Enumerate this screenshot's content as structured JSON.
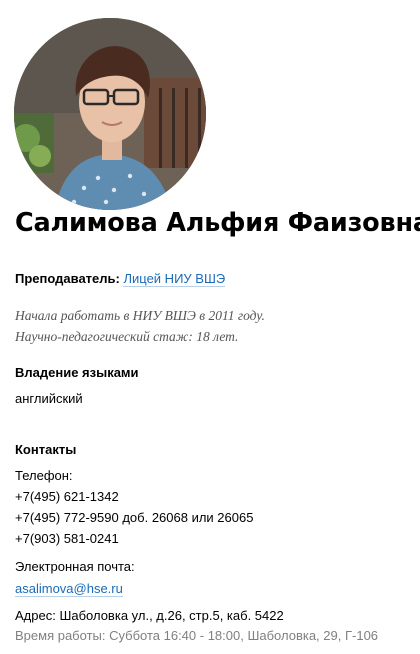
{
  "person": {
    "full_name": "Салимова Альфия Фаизовна",
    "position_label": "Преподаватель:",
    "organization": "Лицей НИУ ВШЭ",
    "bio_line_1": "Начала работать в НИУ ВШЭ в 2011 году.",
    "bio_line_2": "Научно-педагогический стаж: 18 лет."
  },
  "languages": {
    "heading": "Владение языками",
    "value": "английский"
  },
  "contacts": {
    "heading": "Контакты",
    "phone_label": "Телефон:",
    "phones": [
      "+7(495) 621-1342",
      "+7(495) 772-9590 доб. 26068 или 26065",
      "+7(903) 581-0241"
    ],
    "email_label": "Электронная почта:",
    "email": "asalimova@hse.ru",
    "address": "Адрес: Шаболовка ул., д.26, стр.5, каб. 5422",
    "hours": "Время работы: Суббота 16:40 - 18:00, Шаболовка, 29, Г-106"
  }
}
